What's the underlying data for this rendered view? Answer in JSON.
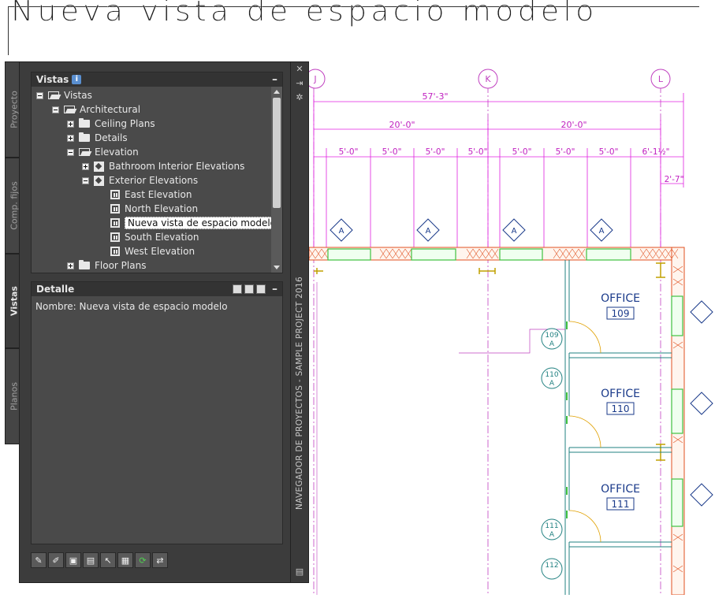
{
  "title": {
    "text": "Nueva vista de espacio modelo"
  },
  "side_tabs": [
    {
      "label": "Proyecto",
      "active": false
    },
    {
      "label": "Comp. fijos",
      "active": false
    },
    {
      "label": "Vistas",
      "active": true
    },
    {
      "label": "Planos",
      "active": false
    }
  ],
  "navigator": {
    "strip_title": "NAVEGADOR DE PROYECTOS - SAMPLE PROJECT 2016",
    "views_panel": {
      "title": "Vistas",
      "tree": [
        {
          "label": "Vistas",
          "icon": "folder-open-icon",
          "expander": "minus"
        },
        {
          "label": "Architectural",
          "icon": "folder-open-icon",
          "expander": "minus"
        },
        {
          "label": "Ceiling Plans",
          "icon": "folder-closed-icon",
          "expander": "plus"
        },
        {
          "label": "Details",
          "icon": "folder-closed-icon",
          "expander": "plus"
        },
        {
          "label": "Elevation",
          "icon": "folder-open-icon",
          "expander": "minus"
        },
        {
          "label": "Bathroom Interior Elevations",
          "icon": "elevation-view-icon",
          "expander": "plus"
        },
        {
          "label": "Exterior Elevations",
          "icon": "elevation-view-icon",
          "expander": "minus"
        },
        {
          "label": "East Elevation",
          "icon": "model-view-icon",
          "expander": "none"
        },
        {
          "label": "North Elevation",
          "icon": "model-view-icon",
          "expander": "none"
        },
        {
          "label": "Nueva vista de espacio modelo",
          "icon": "model-view-icon",
          "expander": "none",
          "selected": true
        },
        {
          "label": "South Elevation",
          "icon": "model-view-icon",
          "expander": "none"
        },
        {
          "label": "West Elevation",
          "icon": "model-view-icon",
          "expander": "none"
        },
        {
          "label": "Floor Plans",
          "icon": "folder-closed-icon",
          "expander": "plus"
        }
      ]
    },
    "detail_panel": {
      "title": "Detalle",
      "text": "Nombre: Nueva vista de espacio modelo"
    },
    "toolbar_icons": [
      "new-view-icon",
      "edit-view-icon",
      "image-view-icon",
      "clipboard-icon",
      "cursor-icon",
      "layout-icon",
      "refresh-icon",
      "repath-icon"
    ]
  },
  "drawing": {
    "grid_bubbles": [
      "J",
      "K",
      "L"
    ],
    "overall_dim": "57'-3\"",
    "sub_dims": [
      "20'-0\"",
      "20'-0\""
    ],
    "small_dims": [
      "5'-0\"",
      "5'-0\"",
      "5'-0\"",
      "5'-0\"",
      "5'-0\"",
      "5'-0\"",
      "5'-0\"",
      "6'-1½\""
    ],
    "side_dim": "2'-7\"",
    "window_tag": "A",
    "rooms": [
      {
        "name": "OFFICE",
        "number": "109"
      },
      {
        "name": "OFFICE",
        "number": "110"
      },
      {
        "name": "OFFICE",
        "number": "111"
      }
    ],
    "door_tags": [
      {
        "number": "109",
        "type": "A"
      },
      {
        "number": "110",
        "type": "A"
      },
      {
        "number": "111",
        "type": "A"
      },
      {
        "number": "112",
        "type": ""
      }
    ],
    "colors": {
      "dim": "#e020e0",
      "wall": "#e05020",
      "partition": "#208080",
      "window": "#40c040",
      "text": "#1a3a8a"
    }
  }
}
